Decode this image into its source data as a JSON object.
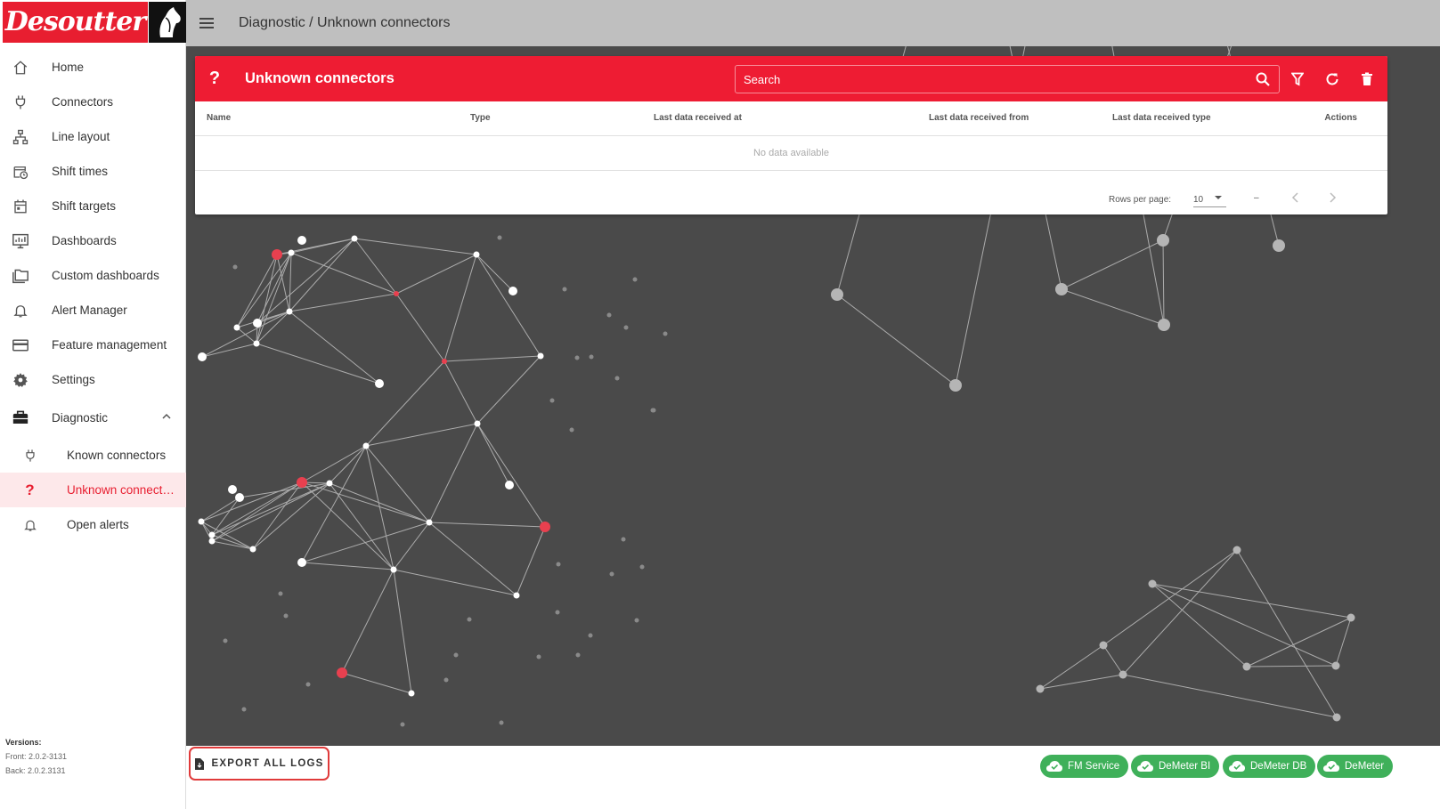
{
  "brand": {
    "name": "Desoutter"
  },
  "header": {
    "breadcrumb": "Diagnostic / Unknown connectors"
  },
  "nav": {
    "home": "Home",
    "connectors": "Connectors",
    "line_layout": "Line layout",
    "shift_times": "Shift times",
    "shift_targets": "Shift targets",
    "dashboards": "Dashboards",
    "custom_dashboards": "Custom dashboards",
    "alert_manager": "Alert Manager",
    "feature_management": "Feature management",
    "settings": "Settings",
    "diagnostic": "Diagnostic",
    "known_connectors": "Known connectors",
    "unknown_connectors": "Unknown connectors",
    "open_alerts": "Open alerts"
  },
  "versions": {
    "title": "Versions:",
    "front": "Front: 2.0.2-3131",
    "back": "Back: 2.0.2.3131"
  },
  "card": {
    "title": "Unknown connectors",
    "search_placeholder": "Search",
    "columns": [
      "Name",
      "Type",
      "Last data received at",
      "Last data received from",
      "Last data received type",
      "Actions"
    ],
    "no_data": "No data available",
    "rows_per_page_label": "Rows per page:",
    "rows_per_page_value": "10",
    "range": "–"
  },
  "footer": {
    "export_label": "EXPORT ALL LOGS",
    "services": [
      "FM Service",
      "DeMeter BI",
      "DeMeter DB",
      "DeMeter"
    ]
  },
  "colors": {
    "brand_red": "#e81e30",
    "status_green": "#3fb05a",
    "background": "#4a4a4a"
  }
}
